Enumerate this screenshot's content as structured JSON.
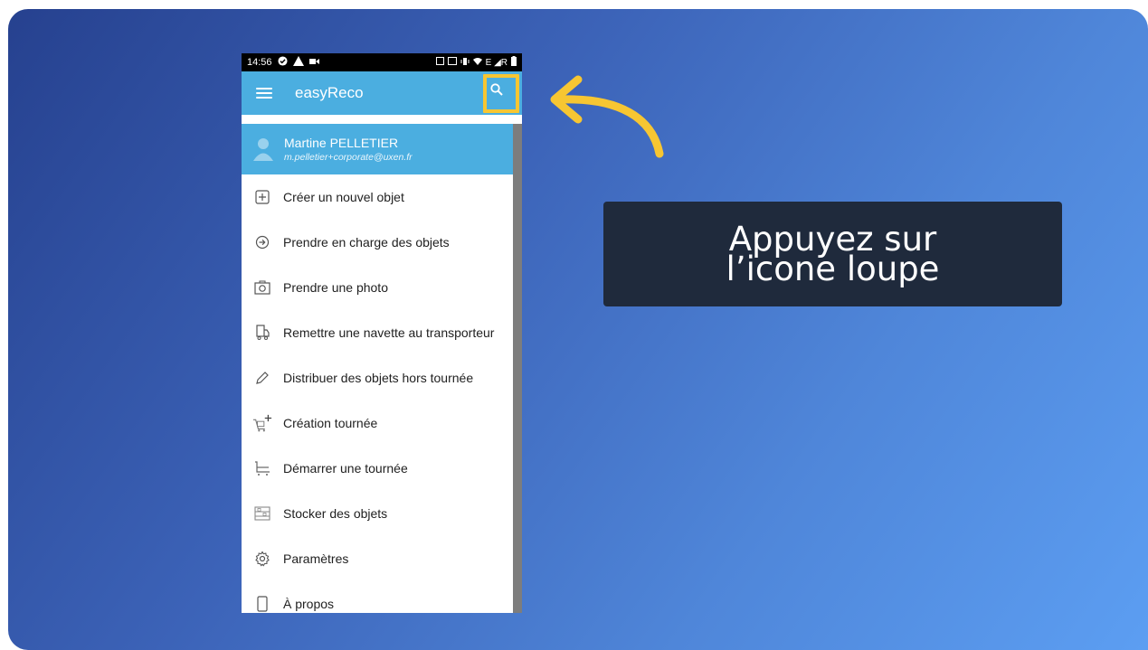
{
  "status_bar": {
    "time": "14:56",
    "right_icons": "E ◢R"
  },
  "app_bar": {
    "title": "easyReco"
  },
  "user": {
    "name": "Martine PELLETIER",
    "email": "m.pelletier+corporate@uxen.fr"
  },
  "menu": {
    "items": [
      {
        "label": "Créer un nouvel objet",
        "icon": "add-box-icon"
      },
      {
        "label": "Prendre en charge des objets",
        "icon": "arrow-circle-icon"
      },
      {
        "label": "Prendre une photo",
        "icon": "camera-icon"
      },
      {
        "label": "Remettre une navette au transporteur",
        "icon": "truck-icon"
      },
      {
        "label": "Distribuer des objets hors tournée",
        "icon": "pen-icon"
      },
      {
        "label": "Création tournée",
        "icon": "cart-plus-icon"
      },
      {
        "label": "Démarrer une tournée",
        "icon": "cart-icon"
      },
      {
        "label": "Stocker des objets",
        "icon": "shelf-icon"
      },
      {
        "label": "Paramètres",
        "icon": "gear-icon"
      },
      {
        "label": "À propos",
        "icon": "phone-icon"
      }
    ]
  },
  "callout": {
    "line1": "Appuyez sur",
    "line2": "l’icone loupe"
  },
  "colors": {
    "accent": "#4baee0",
    "highlight": "#f7c632",
    "callout_bg": "#1f2a3c"
  }
}
